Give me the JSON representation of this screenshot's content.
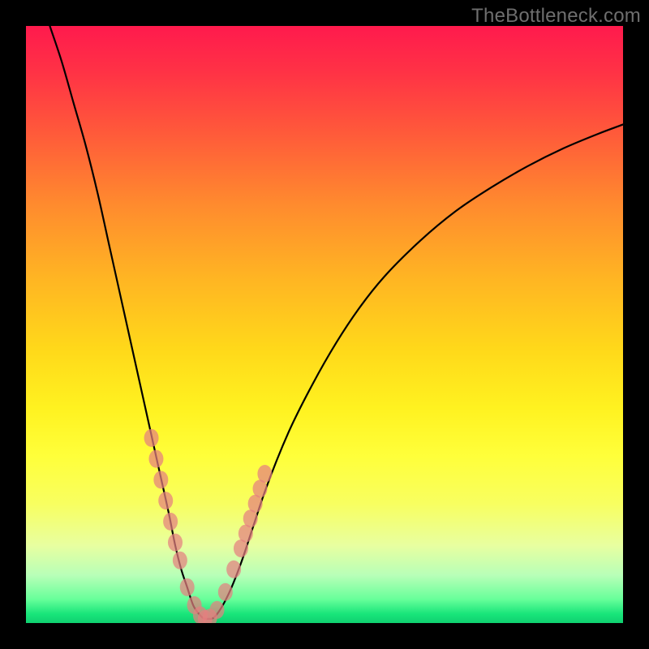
{
  "watermark": "TheBottleneck.com",
  "chart_data": {
    "type": "line",
    "title": "",
    "xlabel": "",
    "ylabel": "",
    "xlim": [
      0,
      100
    ],
    "ylim": [
      0,
      100
    ],
    "grid": false,
    "legend": false,
    "series": [
      {
        "name": "bottleneck-curve",
        "x": [
          4,
          6,
          8,
          10,
          12,
          14,
          16,
          18,
          20,
          22,
          24,
          25,
          26,
          27,
          28,
          29,
          30,
          31,
          32,
          34,
          36,
          38,
          40,
          44,
          48,
          52,
          56,
          60,
          66,
          72,
          78,
          84,
          90,
          96,
          100
        ],
        "y": [
          100,
          94,
          87,
          80,
          72,
          63,
          54,
          45,
          36,
          27,
          18,
          13,
          9,
          6,
          3,
          1.5,
          0.7,
          0.7,
          1.5,
          5,
          10,
          16,
          22,
          32,
          40,
          47,
          53,
          58,
          64,
          69,
          73,
          76.5,
          79.5,
          82,
          83.5
        ]
      }
    ],
    "markers": {
      "name": "highlight-dots",
      "x": [
        21.0,
        21.8,
        22.6,
        23.4,
        24.2,
        25.0,
        25.8,
        27.0,
        28.2,
        29.2,
        30.0,
        30.8,
        32.0,
        33.4,
        34.8,
        36.0,
        36.8,
        37.6,
        38.4,
        39.2,
        40.0
      ],
      "y": [
        31,
        27.5,
        24,
        20.5,
        17,
        13.5,
        10.5,
        6,
        3,
        1.3,
        0.7,
        0.9,
        2.2,
        5.2,
        9,
        12.5,
        15,
        17.5,
        20,
        22.5,
        25
      ]
    }
  }
}
